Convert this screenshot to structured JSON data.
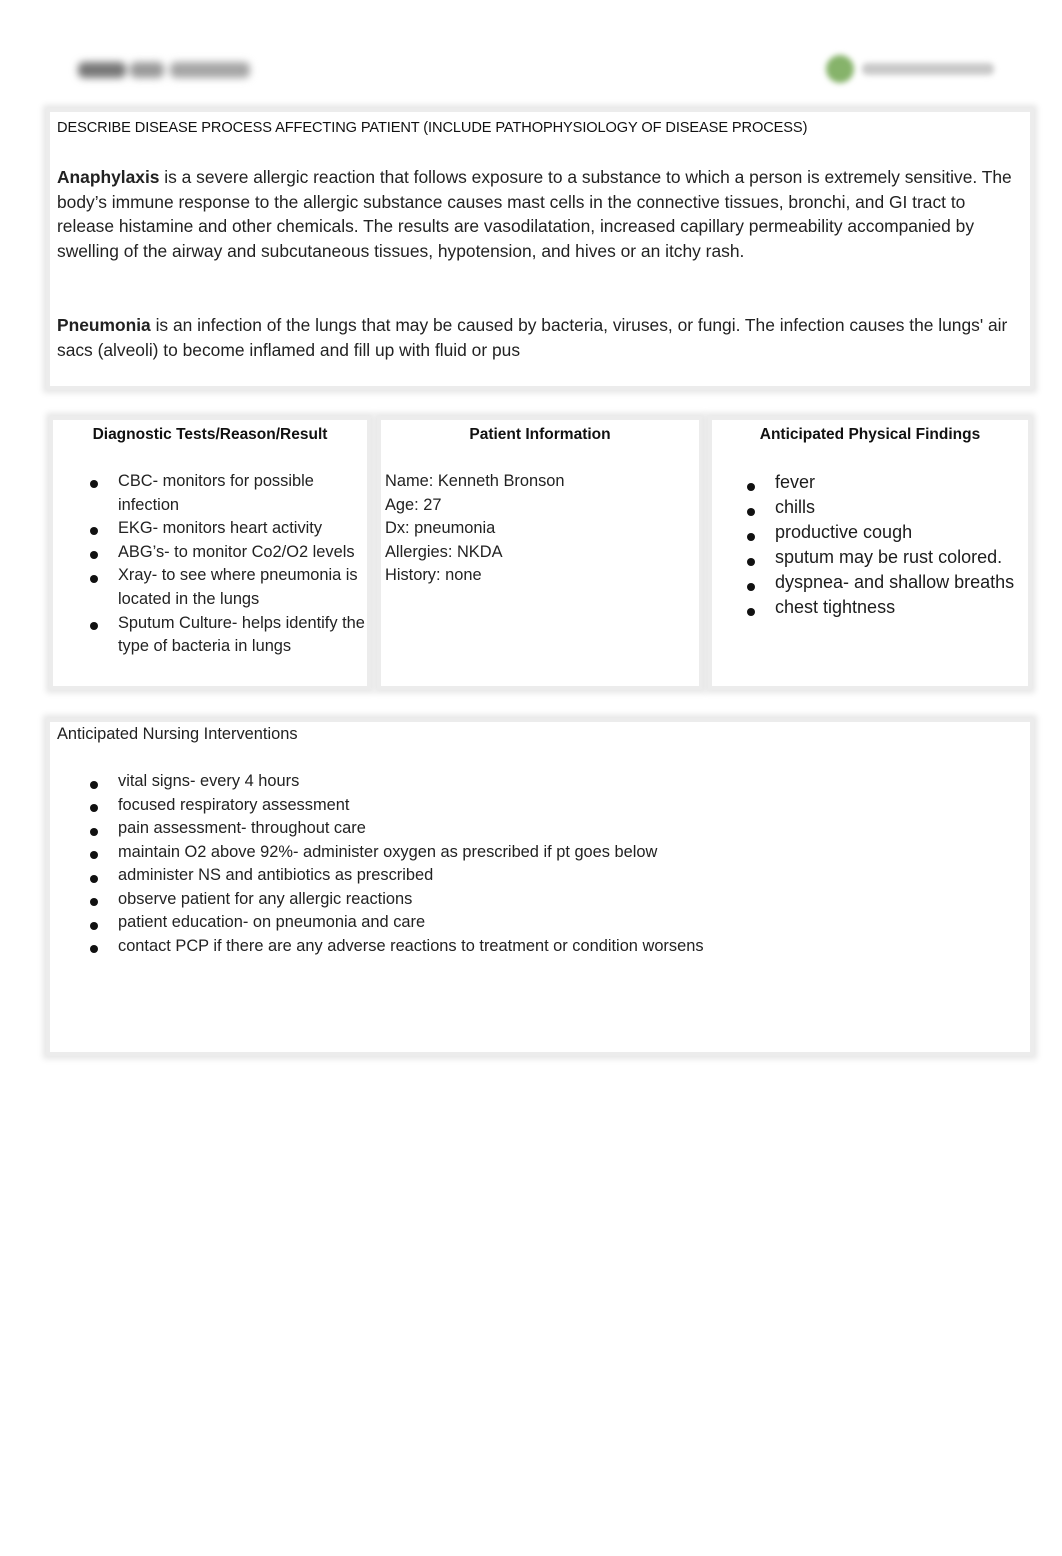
{
  "header": {
    "left_logo": "blurred-brand-logo",
    "right_logo": "blurred-brand-logo-green",
    "right_logo_color": "#86b36a"
  },
  "disease_section": {
    "heading": "DESCRIBE DISEASE PROCESS AFFECTING PATIENT (INCLUDE PATHOPHYSIOLOGY OF DISEASE PROCESS)",
    "anaphylaxis": {
      "term": "Anaphylaxis",
      "text": " is a severe allergic reaction that follows exposure to a substance to which a person is extremely sensitive. The body’s immune response to the allergic substance causes mast cells in the connective tissues, bronchi, and GI tract to release histamine and other chemicals. The results are vasodilatation, increased capillary permeability accompanied by swelling of the airway and subcutaneous tissues, hypotension, and hives or an itchy rash."
    },
    "pneumonia": {
      "term": "Pneumonia",
      "text": " is an infection of the lungs that may be caused by bacteria, viruses, or fungi. The infection causes the lungs' air sacs (alveoli) to become inflamed and fill up with fluid or pus"
    }
  },
  "diagnostic_tests": {
    "title": "Diagnostic Tests/Reason/Result",
    "items": [
      "CBC- monitors for possible infection",
      "EKG- monitors heart activity",
      "ABG’s- to monitor Co2/O2 levels",
      "Xray- to see where pneumonia is located in the lungs",
      "Sputum Culture- helps identify the type of bacteria in lungs"
    ]
  },
  "patient_information": {
    "title": "Patient Information",
    "lines": [
      "Name: Kenneth Bronson",
      "Age: 27",
      "Dx: pneumonia",
      "Allergies: NKDA",
      "History: none"
    ]
  },
  "physical_findings": {
    "title": "Anticipated Physical Findings",
    "items": [
      "fever",
      "chills",
      "productive cough",
      "sputum may be rust colored.",
      "dyspnea- and shallow breaths",
      "chest tightness"
    ]
  },
  "nursing_interventions": {
    "title": "Anticipated Nursing Interventions",
    "items": [
      "vital signs- every 4 hours",
      "focused respiratory assessment",
      "pain assessment- throughout care",
      "maintain O2 above 92%- administer oxygen as prescribed if pt goes below",
      "administer NS and antibiotics as prescribed",
      "observe patient for any allergic reactions",
      "patient education- on pneumonia and care",
      "contact PCP if there are any adverse reactions to treatment or condition worsens"
    ]
  }
}
